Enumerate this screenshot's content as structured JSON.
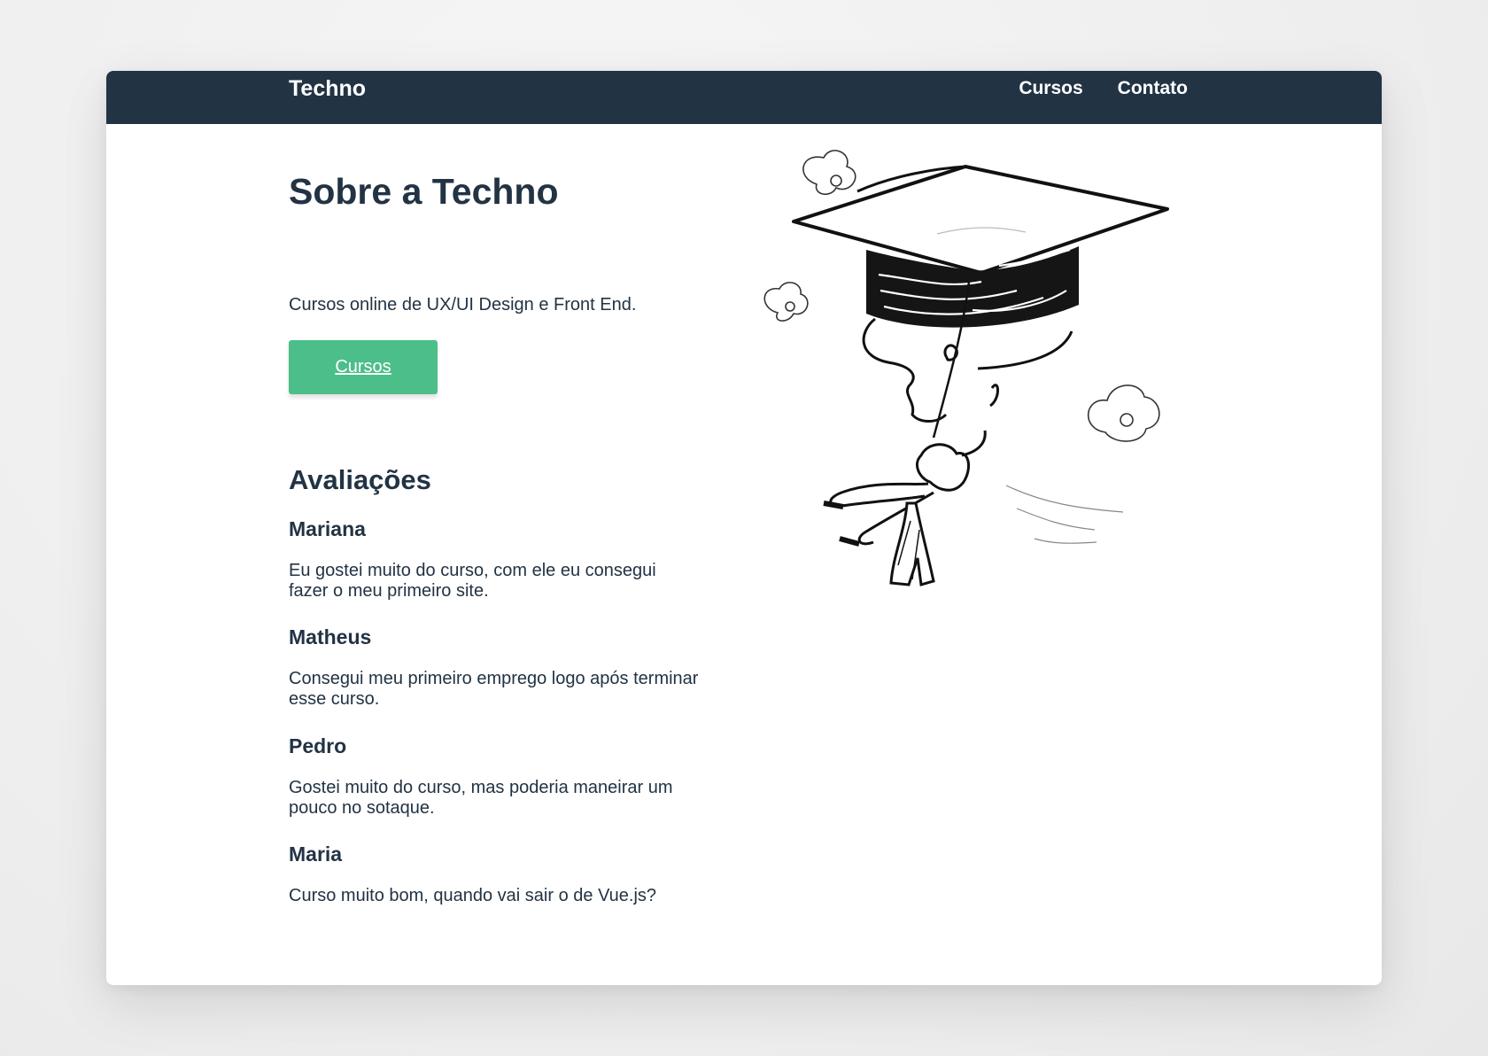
{
  "header": {
    "logo": "Techno",
    "nav": [
      "Cursos",
      "Contato"
    ]
  },
  "hero": {
    "title": "Sobre a Techno",
    "subtitle": "Cursos online de UX/UI Design e Front End.",
    "button_label": "Cursos"
  },
  "reviews": {
    "title": "Avaliações",
    "items": [
      {
        "name": "Mariana",
        "text": "Eu gostei muito do curso, com ele eu consegui fazer o meu primeiro site."
      },
      {
        "name": "Matheus",
        "text": "Consegui meu primeiro emprego logo após terminar esse curso."
      },
      {
        "name": "Pedro",
        "text": "Gostei muito do curso, mas poderia maneirar um pouco no sotaque."
      },
      {
        "name": "Maria",
        "text": "Curso muito bom, quando vai sair o de Vue.js?"
      }
    ]
  },
  "illustration": {
    "icon": "graduation-cap-swing-illustration"
  },
  "colors": {
    "header_bg": "#223344",
    "text": "#223344",
    "button_bg": "#4cbe8a",
    "page_bg": "#efefef"
  }
}
